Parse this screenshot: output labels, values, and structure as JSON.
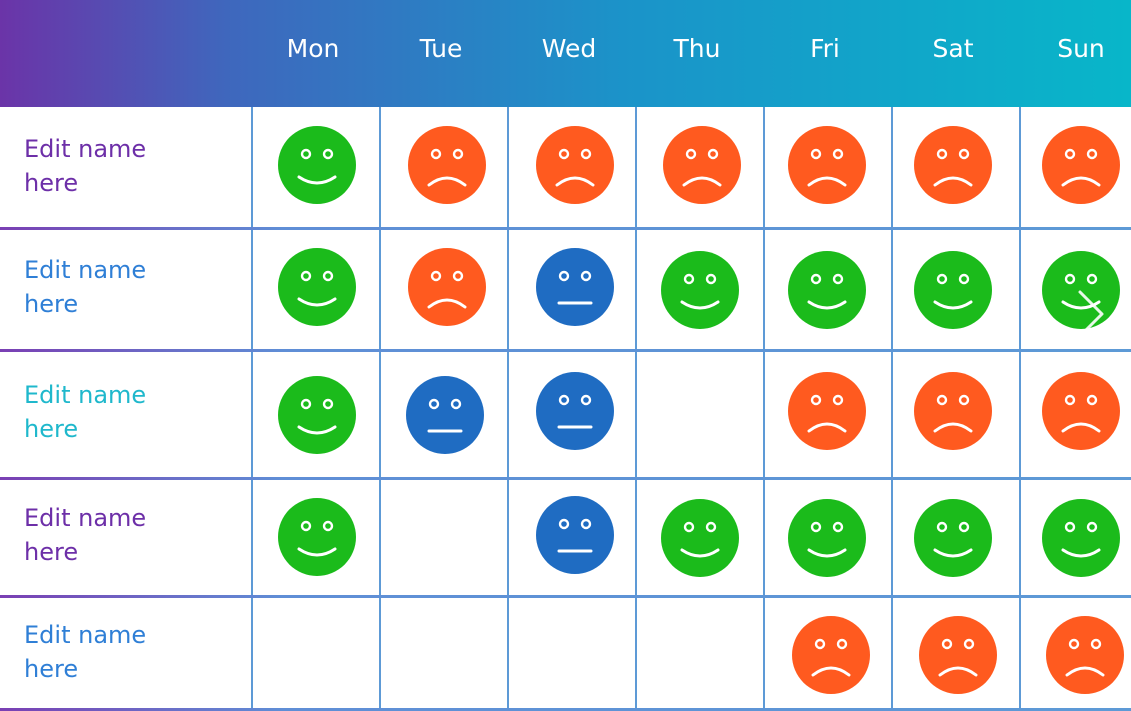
{
  "columns": [
    "Mon",
    "Tue",
    "Wed",
    "Thu",
    "Fri",
    "Sat",
    "Sun"
  ],
  "colors": {
    "happy": "#1bbb1b",
    "sad": "#ff5a1f",
    "neutral": "#1f6cc2",
    "grid": "#5d9ad6"
  },
  "rows": [
    {
      "name": "Edit name here",
      "name_color": "#6d2fa8",
      "moods": [
        "happy",
        "sad",
        "sad",
        "sad",
        "sad",
        "sad",
        "sad"
      ]
    },
    {
      "name": "Edit name here",
      "name_color": "#2f7fd6",
      "moods": [
        "happy",
        "sad",
        "neutral",
        "happy",
        "happy",
        "happy",
        "happy"
      ]
    },
    {
      "name": "Edit name here",
      "name_color": "#1fb8cc",
      "moods": [
        "happy",
        "neutral",
        "neutral",
        null,
        "sad",
        "sad",
        "sad"
      ]
    },
    {
      "name": "Edit name here",
      "name_color": "#6d2fa8",
      "moods": [
        "happy",
        null,
        "neutral",
        "happy",
        "happy",
        "happy",
        "happy"
      ]
    },
    {
      "name": "Edit name here",
      "name_color": "#2f7fd6",
      "moods": [
        null,
        null,
        null,
        null,
        "sad",
        "sad",
        "sad"
      ]
    }
  ],
  "icons": {
    "next": "chevron-right-icon"
  }
}
